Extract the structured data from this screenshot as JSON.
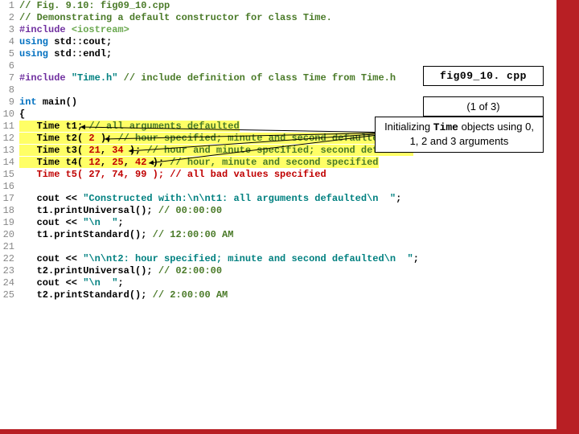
{
  "file_label": "fig09_10. cpp",
  "page_indicator": "(1 of 3)",
  "annotation_pre": "Initializing ",
  "annotation_tt": "Time",
  "annotation_post": " objects using 0, 1, 2 and 3 arguments",
  "code": {
    "l1_cmt": "// Fig. 9.10: fig09_10.cpp",
    "l2_cmt": "// Demonstrating a default constructor for class Time.",
    "l3_pp": "#include ",
    "l3_hdr": "<iostream>",
    "l4_a": "using ",
    "l4_b": "std::cout;",
    "l5_a": "using ",
    "l5_b": "std::endl;",
    "l7_pp": "#include ",
    "l7_str": "\"Time.h\"",
    "l7_cmt": " // include definition of class Time from Time.h",
    "l9_a": "int ",
    "l9_b": "main()",
    "l10": "{",
    "l11_a": "   Time t1; ",
    "l11_c": "// all arguments defaulted",
    "l12_a": "   Time t2( ",
    "l12_n": "2",
    "l12_b": " ); ",
    "l12_c": "// hour specified; minute and second defaulted",
    "l13_a": "   Time t3( ",
    "l13_n1": "21",
    "l13_m": ", ",
    "l13_n2": "34",
    "l13_b": " ); ",
    "l13_c": "// hour and minute specified; second defaulted",
    "l14_a": "   Time t4( ",
    "l14_n1": "12",
    "l14_m1": ", ",
    "l14_n2": "25",
    "l14_m2": ", ",
    "l14_n3": "42",
    "l14_b": " ); ",
    "l14_c": "// hour, minute and second specified",
    "l15": "   Time t5( 27, 74, 99 ); // all bad values specified",
    "l17_a": "   cout << ",
    "l17_s": "\"Constructed with:\\n\\nt1: all arguments defaulted\\n  \"",
    "l17_b": ";",
    "l18_a": "   t1.printUniversal(); ",
    "l18_c": "// 00:00:00",
    "l19_a": "   cout << ",
    "l19_s": "\"\\n  \"",
    "l19_b": ";",
    "l20_a": "   t1.printStandard(); ",
    "l20_c": "// 12:00:00 AM",
    "l22_a": "   cout << ",
    "l22_s": "\"\\n\\nt2: hour specified; minute and second defaulted\\n  \"",
    "l22_b": ";",
    "l23_a": "   t2.printUniversal(); ",
    "l23_c": "// 02:00:00",
    "l24_a": "   cout << ",
    "l24_s": "\"\\n  \"",
    "l24_b": ";",
    "l25_a": "   t2.printStandard(); ",
    "l25_c": "// 2:00:00 AM"
  },
  "line_numbers": [
    "1",
    "2",
    "3",
    "4",
    "5",
    "6",
    "7",
    "8",
    "9",
    "10",
    "11",
    "12",
    "13",
    "14",
    "15",
    "16",
    "17",
    "18",
    "19",
    "20",
    "21",
    "22",
    "23",
    "24",
    "25"
  ]
}
